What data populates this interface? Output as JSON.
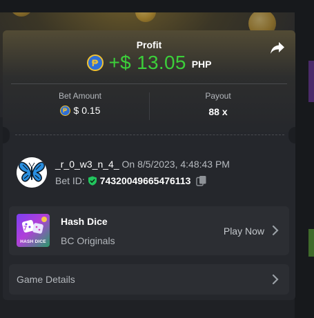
{
  "profit": {
    "label": "Profit",
    "amount": "+$ 13.05",
    "currency": "PHP",
    "currency_symbol": "₱",
    "amount_color": "#3ccf3a"
  },
  "share": {
    "icon": "share-arrow-icon"
  },
  "bet_amount": {
    "label": "Bet Amount",
    "value": "$ 0.15",
    "currency_symbol": "₱"
  },
  "payout": {
    "label": "Payout",
    "value": "88 x"
  },
  "bettor": {
    "username": "_r_0_w3_n_4_",
    "on_date": "On 8/5/2023, 4:48:43 PM",
    "bet_id_label": "Bet ID:",
    "bet_id": "74320049665476113",
    "avatar_icon": "butterfly-avatar-icon",
    "verified_icon": "green-shield-check-icon",
    "copy_icon": "copy-icon"
  },
  "game": {
    "name": "Hash Dice",
    "provider": "BC Originals",
    "thumb_text": "HASH DICE",
    "play_label": "Play Now"
  },
  "details": {
    "label": "Game Details"
  },
  "colors": {
    "background": "#1c1e22",
    "card": "#25272c",
    "row": "#2c2e33",
    "accent_green": "#3ccf3a",
    "peso_blue": "#2f6fd6",
    "peso_gold": "#f1c232"
  }
}
